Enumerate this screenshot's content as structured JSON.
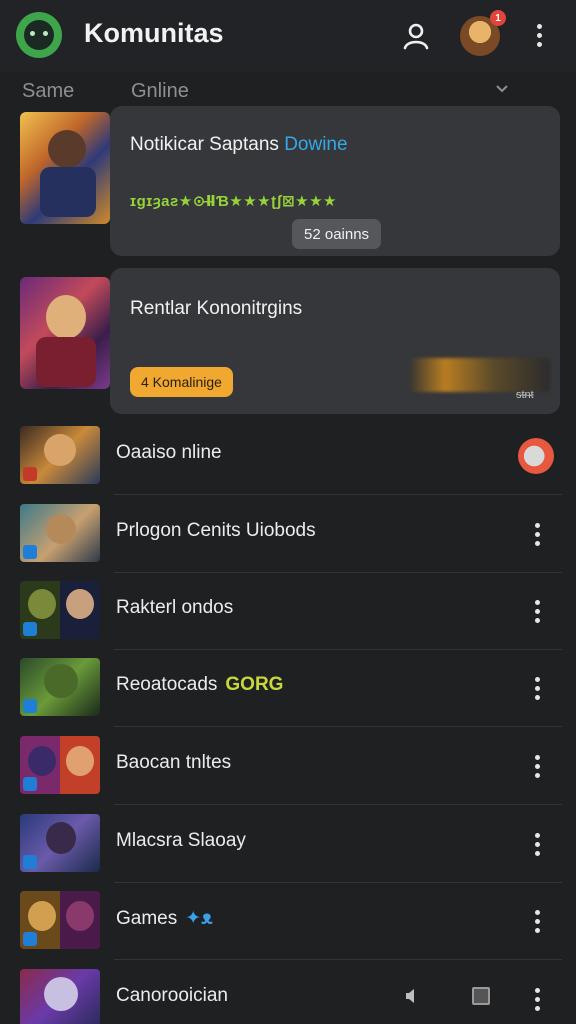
{
  "header": {
    "title": "Komunitas",
    "notification_count": "1",
    "icons": [
      "logo-icon",
      "user-icon",
      "avatar",
      "more-icon"
    ]
  },
  "filters": {
    "left_label": "Same",
    "middle_label": "Gnline"
  },
  "featured": [
    {
      "title": "Notikicar Saptans",
      "title_accent": "Dowine",
      "stars_text": "ɪɡɪȝaƨ★⊙Ⅱ̶Ɓ★★★ʈʃ⊠★★★",
      "pill": "52 oainns"
    },
    {
      "title": "Rentlar Kononitrgins",
      "button": "4 Komalinige",
      "small_text": "ᵴᵵᵰᵵ"
    }
  ],
  "list": [
    {
      "label": "Oaaiso nline",
      "tag": "",
      "action": "status-dot"
    },
    {
      "label": "Prlogon Cenits Uiobods",
      "tag": "",
      "action": "kebab"
    },
    {
      "label": "Rakterl ondos",
      "tag": "",
      "action": "kebab"
    },
    {
      "label": "Reoatocads",
      "tag": "GORG",
      "tag_color": "#c9d73a",
      "action": "kebab"
    },
    {
      "label": "Baocan tnltes",
      "tag": "",
      "action": "kebab"
    },
    {
      "label": "Mlacsra Slaoay",
      "tag": "",
      "action": "kebab"
    },
    {
      "label": "Games",
      "tag": "✦ᴥ",
      "tag_color": "#3aa0e8",
      "action": "kebab"
    },
    {
      "label": "Canorooician",
      "tag": "",
      "action": "kebab"
    }
  ],
  "colors": {
    "background": "#1f2022",
    "card": "#36373b",
    "brand_green": "#3ea54b",
    "accent_blue": "#35a8e6",
    "accent_orange": "#f0a830",
    "star_green": "#97d43a"
  }
}
